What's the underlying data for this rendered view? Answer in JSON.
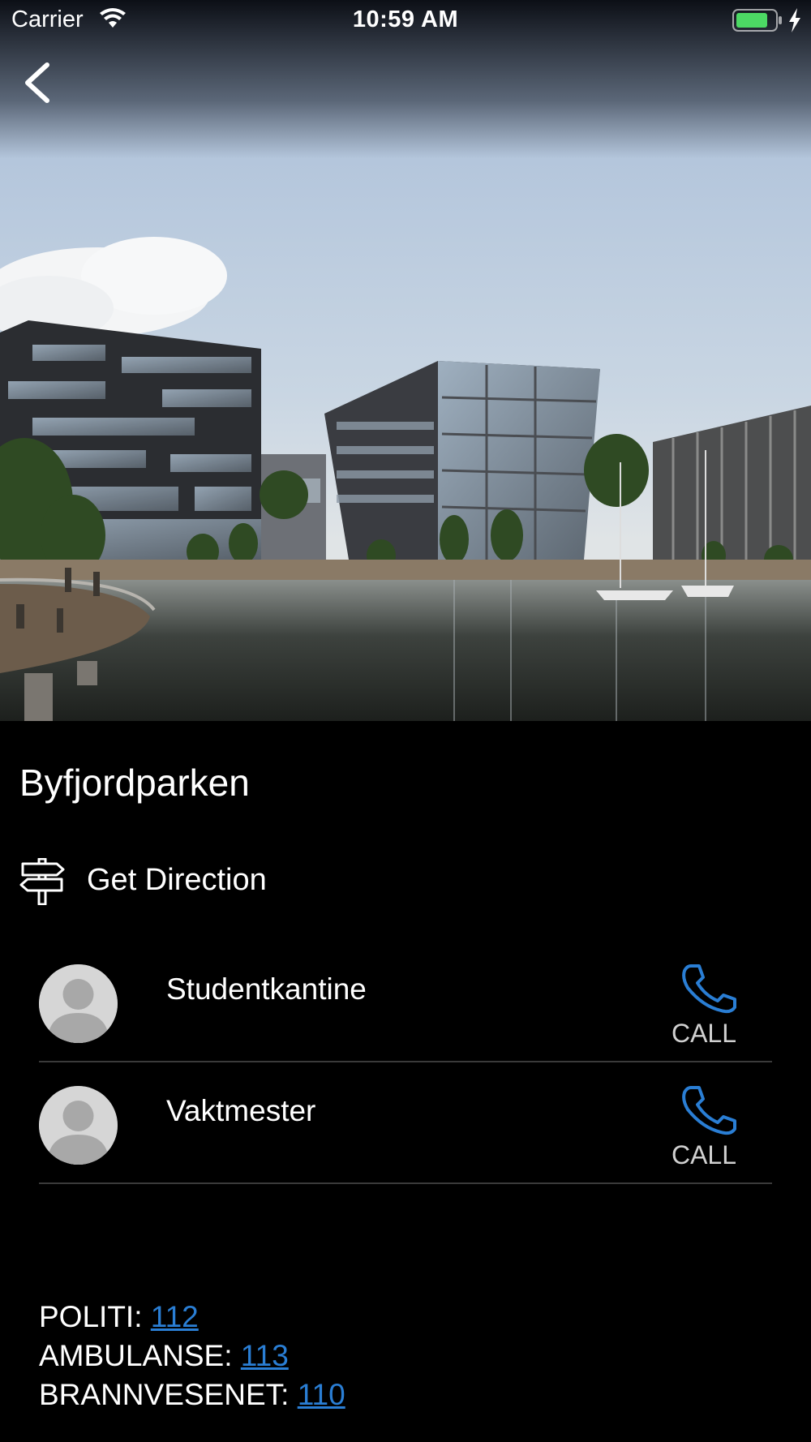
{
  "status_bar": {
    "carrier": "Carrier",
    "time": "10:59 AM",
    "battery_color": "#4cd964"
  },
  "header": {
    "back_icon": "chevron-left-icon",
    "hero_image": "waterfront buildings with boats"
  },
  "place": {
    "title": "Byfjordparken"
  },
  "direction": {
    "icon": "signpost-icon",
    "label": "Get Direction"
  },
  "contacts": [
    {
      "name": "Studentkantine",
      "call_label": "CALL",
      "icon": "phone-icon"
    },
    {
      "name": "Vaktmester",
      "call_label": "CALL",
      "icon": "phone-icon"
    }
  ],
  "emergency": [
    {
      "label": "POLITI: ",
      "number": "112"
    },
    {
      "label": "AMBULANSE: ",
      "number": "113"
    },
    {
      "label": "BRANNVESENET: ",
      "number": "110"
    }
  ],
  "colors": {
    "accent": "#2a7ed4",
    "background": "#000000",
    "divider": "#3a3a3a"
  }
}
